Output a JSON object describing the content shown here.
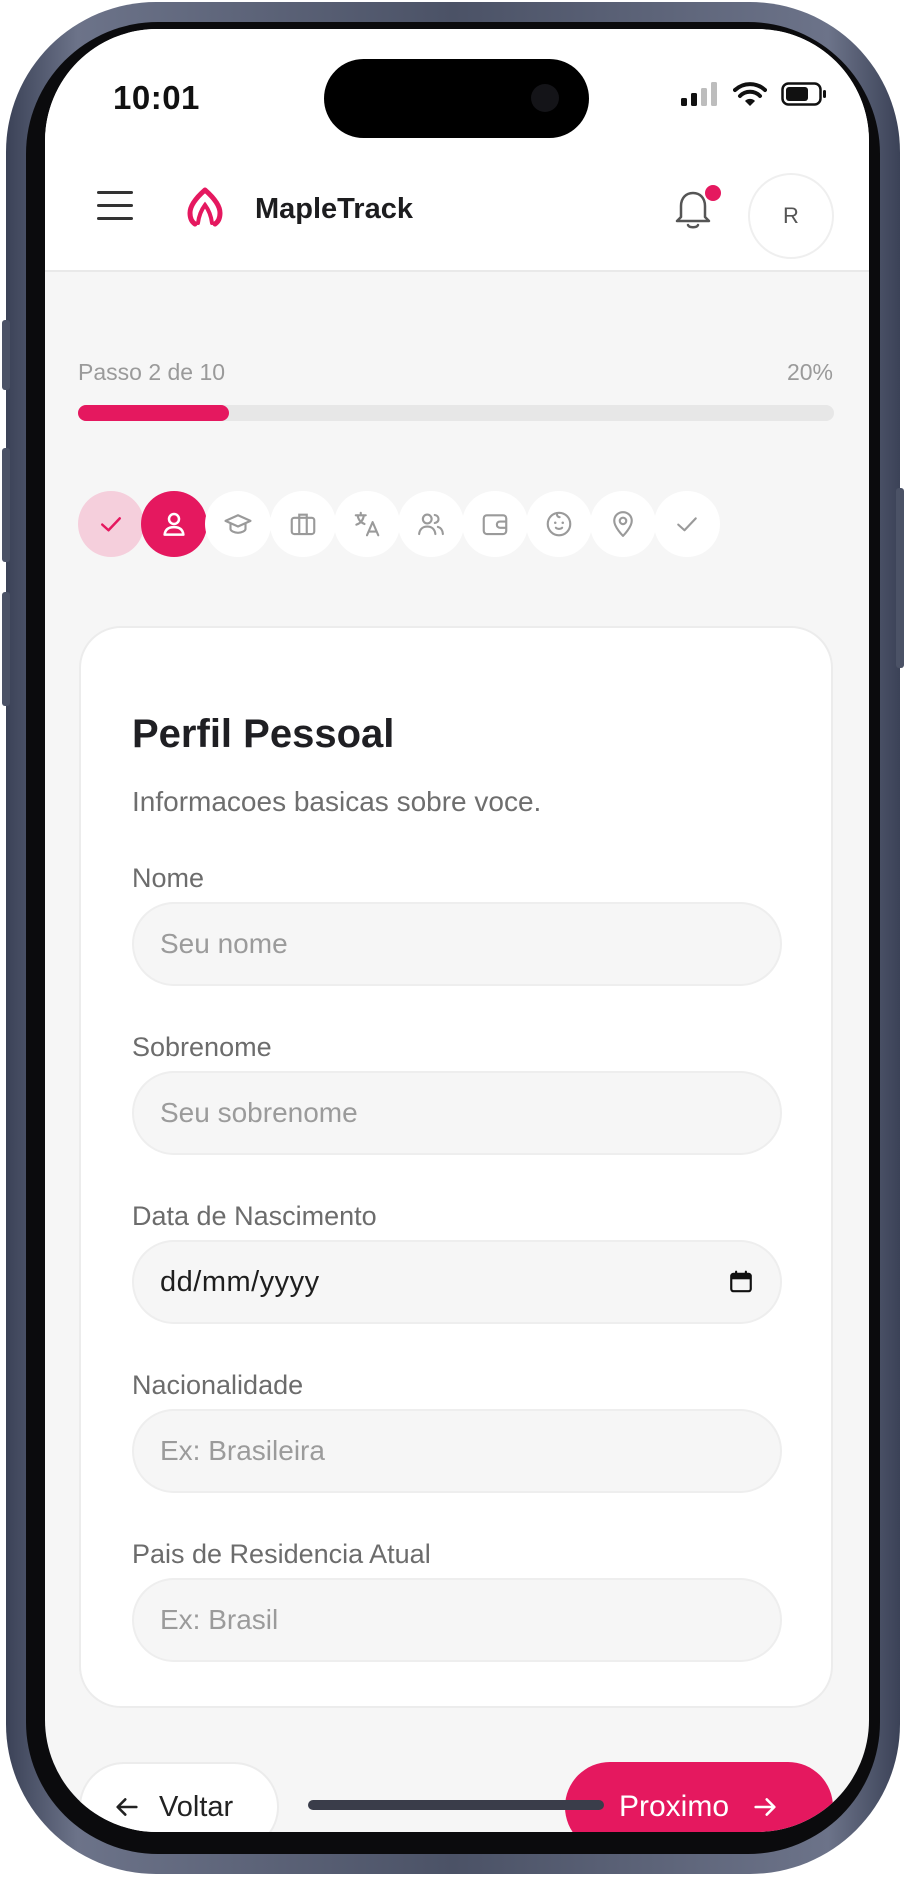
{
  "status_bar": {
    "time": "10:01"
  },
  "header": {
    "brand_name": "MapleTrack",
    "avatar_initial": "R",
    "notification_badge": true,
    "accent_color": "#e5185f"
  },
  "progress": {
    "step_text": "Passo 2 de 10",
    "percent_text": "20%",
    "fraction": 0.2
  },
  "steps": [
    {
      "icon": "check-icon",
      "state": "done"
    },
    {
      "icon": "user-icon",
      "state": "active"
    },
    {
      "icon": "graduation-cap-icon",
      "state": "pending"
    },
    {
      "icon": "briefcase-icon",
      "state": "pending"
    },
    {
      "icon": "translate-icon",
      "state": "pending"
    },
    {
      "icon": "users-icon",
      "state": "pending"
    },
    {
      "icon": "wallet-icon",
      "state": "pending"
    },
    {
      "icon": "baby-face-icon",
      "state": "pending"
    },
    {
      "icon": "map-pin-icon",
      "state": "pending"
    },
    {
      "icon": "check-icon",
      "state": "pending"
    }
  ],
  "form": {
    "title": "Perfil Pessoal",
    "description": "Informacoes basicas sobre voce.",
    "fields": {
      "first_name": {
        "label": "Nome",
        "placeholder": "Seu nome",
        "value": ""
      },
      "last_name": {
        "label": "Sobrenome",
        "placeholder": "Seu sobrenome",
        "value": ""
      },
      "birth_date": {
        "label": "Data de Nascimento",
        "placeholder": "dd/mm/yyyy",
        "value": ""
      },
      "nationality": {
        "label": "Nacionalidade",
        "placeholder": "Ex: Brasileira",
        "value": ""
      },
      "residence_country": {
        "label": "Pais de Residencia Atual",
        "placeholder": "Ex: Brasil",
        "value": ""
      }
    }
  },
  "navigation": {
    "back_label": "Voltar",
    "next_label": "Proximo"
  }
}
